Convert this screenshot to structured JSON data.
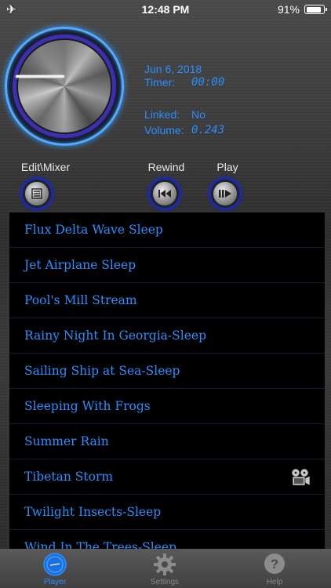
{
  "status_bar": {
    "time": "12:48 PM",
    "battery": "91%",
    "battery_level": 0.91
  },
  "info": {
    "date": "Jun 6, 2018",
    "timer_label": "Timer:",
    "timer_value": "00:00",
    "linked_label": "Linked:",
    "linked_value": "No",
    "volume_label": "Volume:",
    "volume_value": "0.243"
  },
  "controls": {
    "edit_mixer_label": "Edit\\Mixer",
    "rewind_label": "Rewind",
    "play_label": "Play"
  },
  "tracks": [
    {
      "title": "Flux Delta Wave Sleep"
    },
    {
      "title": "Jet Airplane Sleep"
    },
    {
      "title": "Pool's Mill Stream"
    },
    {
      "title": "Rainy Night In Georgia-Sleep"
    },
    {
      "title": "Sailing Ship at Sea-Sleep"
    },
    {
      "title": "Sleeping With Frogs"
    },
    {
      "title": "Summer Rain"
    },
    {
      "title": "Tibetan Storm",
      "icon": "film-reel-icon"
    },
    {
      "title": "Twilight Insects-Sleep"
    },
    {
      "title": "Wind In The Trees-Sleep"
    }
  ],
  "tabs": [
    {
      "label": "Player",
      "icon": "player-icon",
      "active": true
    },
    {
      "label": "Settings",
      "icon": "gear-icon",
      "active": false
    },
    {
      "label": "Help",
      "icon": "question-icon",
      "active": false
    }
  ],
  "colors": {
    "accent": "#2a8fff",
    "ring": "#3c2fb0",
    "list_bg": "#000000"
  }
}
